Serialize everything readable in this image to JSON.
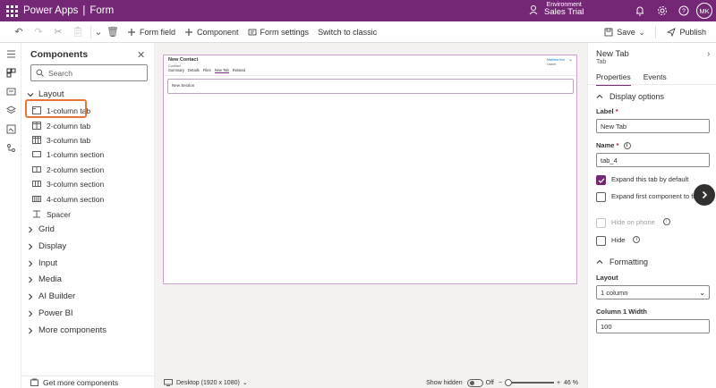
{
  "header": {
    "app_name": "Power Apps",
    "separator": "|",
    "page_name": "Form",
    "env_label": "Environment",
    "env_name": "Sales Trial",
    "avatar_initials": "MK",
    "bg_color": "#742774"
  },
  "commandbar": {
    "form_field": "Form field",
    "component": "Component",
    "form_settings": "Form settings",
    "switch_classic": "Switch to classic",
    "save": "Save",
    "publish": "Publish"
  },
  "components": {
    "title": "Components",
    "search_placeholder": "Search",
    "layout_section": "Layout",
    "layout_items": [
      {
        "label": "1-column tab",
        "icon": "one-column-tab-icon"
      },
      {
        "label": "2-column tab",
        "icon": "two-column-tab-icon"
      },
      {
        "label": "3-column tab",
        "icon": "three-column-tab-icon"
      },
      {
        "label": "1-column section",
        "icon": "one-column-section-icon"
      },
      {
        "label": "2-column section",
        "icon": "two-column-section-icon"
      },
      {
        "label": "3-column section",
        "icon": "three-column-section-icon"
      },
      {
        "label": "4-column section",
        "icon": "four-column-section-icon"
      },
      {
        "label": "Spacer",
        "icon": "spacer-icon"
      }
    ],
    "groups": [
      "Grid",
      "Display",
      "Input",
      "Media",
      "AI Builder",
      "Power BI",
      "More components"
    ],
    "get_more": "Get more components"
  },
  "form": {
    "title": "New Contact",
    "subtitle": "Contact",
    "owner_name": "Matthew Kim",
    "owner_label": "Owner",
    "tabs": [
      "Summary",
      "Details",
      "Files",
      "New Tab",
      "Related"
    ],
    "active_tab": "New Tab",
    "section_name": "New Section"
  },
  "statusbar": {
    "device": "Desktop (1920 x 1080)",
    "show_hidden": "Show hidden",
    "toggle_state": "Off",
    "zoom": "46 %"
  },
  "properties": {
    "title": "New Tab",
    "subtitle": "Tab",
    "tabs": [
      "Properties",
      "Events"
    ],
    "display_options": "Display options",
    "label_label": "Label",
    "label_value": "New Tab",
    "name_label": "Name",
    "name_value": "tab_4",
    "expand_default": "Expand this tab by default",
    "expand_first": "Expand first component to full tab",
    "hide_phone": "Hide on phone",
    "hide": "Hide",
    "formatting": "Formatting",
    "layout_label": "Layout",
    "layout_value": "1 column",
    "col_width_label": "Column 1 Width",
    "col_width_value": "100"
  }
}
